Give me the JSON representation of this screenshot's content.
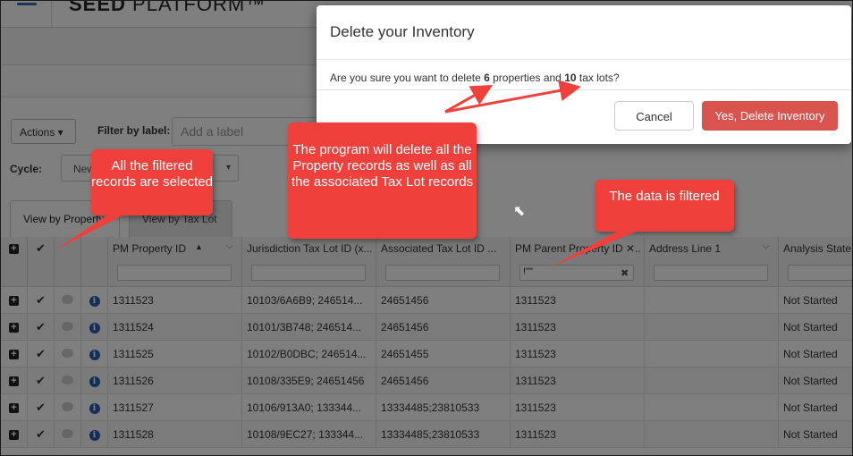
{
  "app": {
    "brand": "SEED",
    "brand_suffix": "PLATFORM™"
  },
  "toolbar": {
    "actions_label": "Actions ▾",
    "filter_label": "Filter by label:",
    "label_placeholder": "Add a label",
    "cycle_label": "Cycle:",
    "cycle_value": "New",
    "cycle_caret": "▾"
  },
  "tabs": [
    {
      "label": "View by Property"
    },
    {
      "label": "View by Tax Lot"
    }
  ],
  "columns": [
    {
      "label": "PM Property ID",
      "sort": "▲",
      "filter": ""
    },
    {
      "label": "Jurisdiction Tax Lot ID (x...",
      "filter": ""
    },
    {
      "label": "Associated Tax Lot ID ...",
      "filter": ""
    },
    {
      "label": "PM Parent Property ID ✕...",
      "filter": "!\"\""
    },
    {
      "label": "Address Line 1",
      "filter": ""
    },
    {
      "label": "Analysis State",
      "filter": ""
    }
  ],
  "rows": [
    {
      "pm_id": "1311523",
      "jurisdiction": "10103/6A6B9; 246514...",
      "associated": "24651456",
      "parent": "1311523",
      "address": "",
      "state": "Not Started"
    },
    {
      "pm_id": "1311524",
      "jurisdiction": "10101/3B748; 246514...",
      "associated": "24651456",
      "parent": "1311523",
      "address": "",
      "state": "Not Started"
    },
    {
      "pm_id": "1311525",
      "jurisdiction": "10102/B0DBC; 246514...",
      "associated": "24651455",
      "parent": "1311523",
      "address": "",
      "state": "Not Started"
    },
    {
      "pm_id": "1311526",
      "jurisdiction": "10108/335E9; 24651456",
      "associated": "24651456",
      "parent": "1311523",
      "address": "",
      "state": "Not Started"
    },
    {
      "pm_id": "1311527",
      "jurisdiction": "10106/913A0; 133344...",
      "associated": "13334485;23810533",
      "parent": "1311523",
      "address": "",
      "state": "Not Started"
    },
    {
      "pm_id": "1311528",
      "jurisdiction": "10108/9EC27; 133344...",
      "associated": "13334485;23810533",
      "parent": "1311523",
      "address": "",
      "state": "Not Started"
    }
  ],
  "modal": {
    "title": "Delete your Inventory",
    "body_pre": "Are you sure you want to delete ",
    "property_count": "6",
    "body_mid": " properties and ",
    "taxlot_count": "10",
    "body_post": " tax lots?",
    "cancel_label": "Cancel",
    "confirm_label": "Yes, Delete Inventory"
  },
  "callouts": {
    "filtered_selected": "All the filtered records are selected",
    "program_deletes": "The program will delete all the Property records as well as all the associated Tax Lot records",
    "data_filtered": "The data is filtered"
  },
  "colors": {
    "accent": "#d9534f",
    "callout": "#f0403c",
    "info_icon": "#2a5fb0"
  },
  "icons": {
    "menu": "hamburger-icon",
    "expand": "plus-square-icon",
    "checked": "check-icon",
    "note": "comment-icon",
    "info": "info-circle-icon"
  }
}
